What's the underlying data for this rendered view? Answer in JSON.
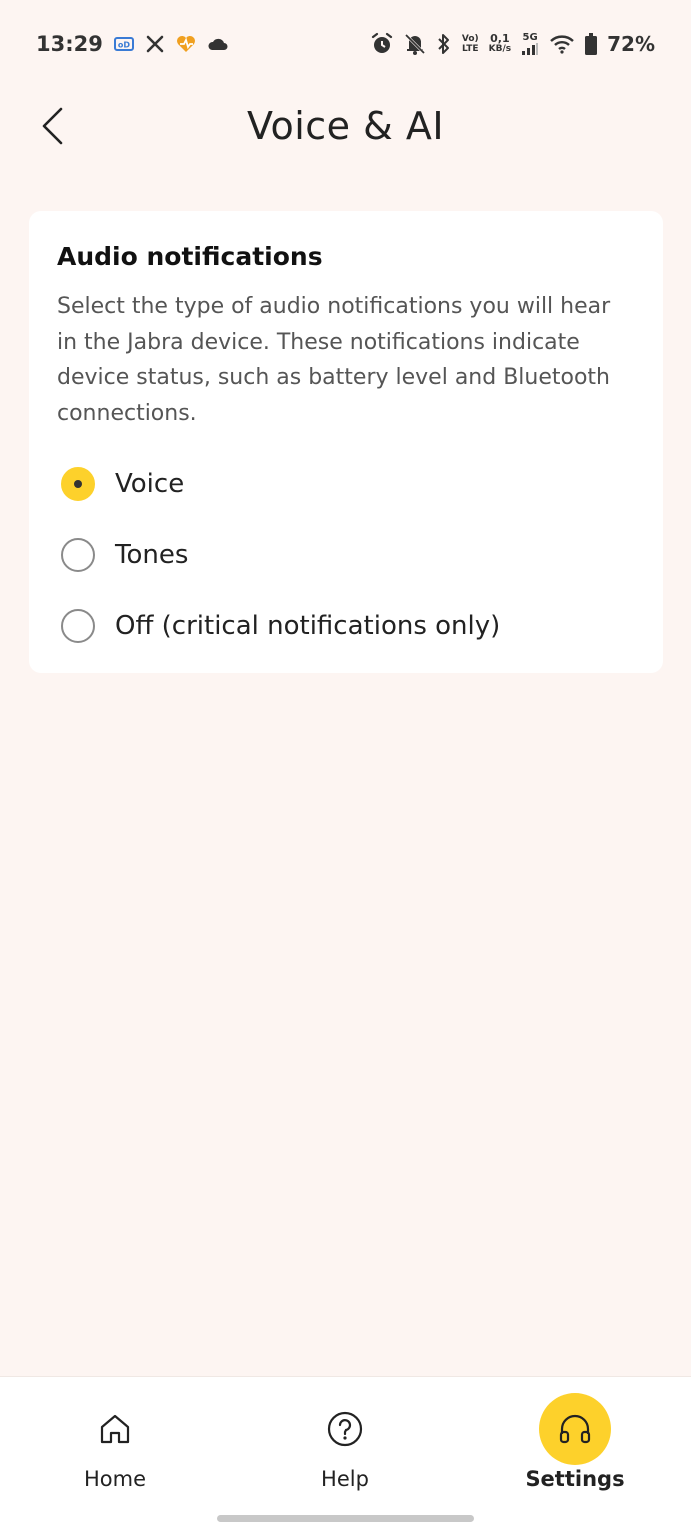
{
  "status_bar": {
    "time": "13:29",
    "net_speed_top": "0,1",
    "net_speed_bottom": "KB/s",
    "volte_top": "Vo)",
    "volte_bottom": "LTE",
    "signal_label": "5G",
    "battery": "72%"
  },
  "header": {
    "title": "Voice & AI"
  },
  "card": {
    "title": "Audio notifications",
    "description": "Select the type of audio notifications you will hear in the Jabra device. These notifications indicate device status, such as battery level and Bluetooth connections.",
    "options": [
      {
        "label": "Voice",
        "selected": true
      },
      {
        "label": "Tones",
        "selected": false
      },
      {
        "label": "Off (critical notifications only)",
        "selected": false
      }
    ]
  },
  "bottom_nav": {
    "items": [
      {
        "label": "Home",
        "icon": "home-icon",
        "active": false
      },
      {
        "label": "Help",
        "icon": "help-icon",
        "active": false
      },
      {
        "label": "Settings",
        "icon": "headphones-icon",
        "active": true
      }
    ]
  },
  "colors": {
    "accent": "#fdd12b",
    "background": "#fdf5f2",
    "card": "#ffffff"
  }
}
